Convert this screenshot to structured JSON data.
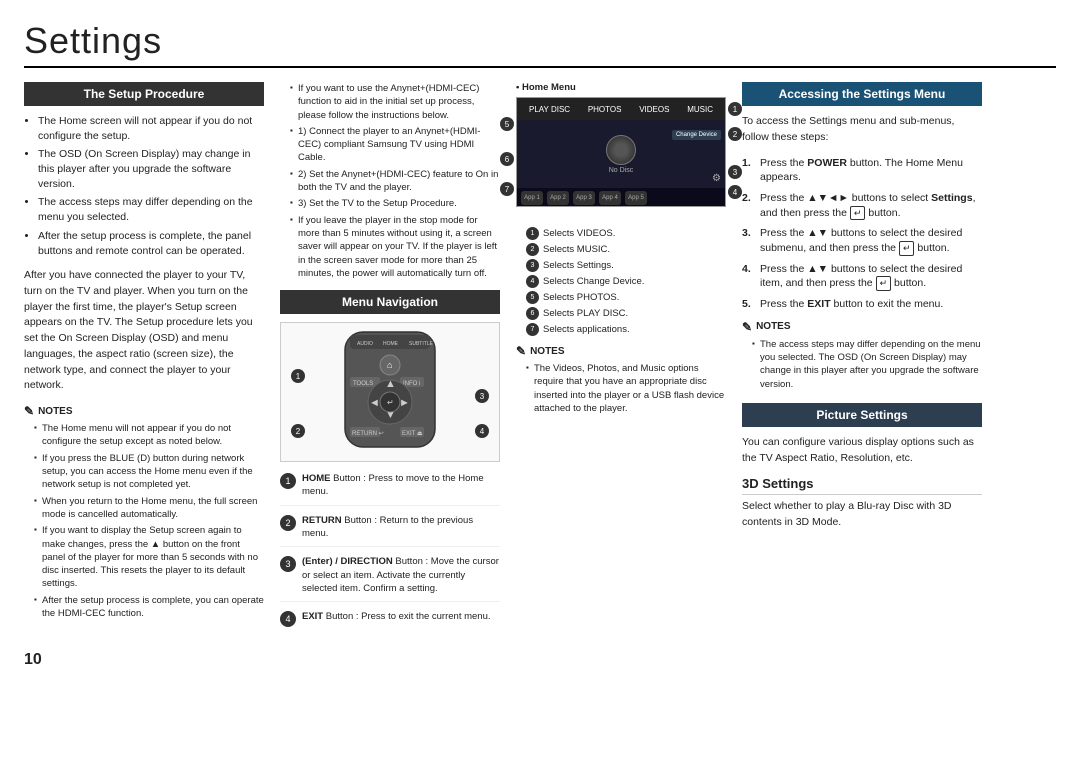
{
  "page": {
    "title": "Settings",
    "page_number": "10"
  },
  "col1": {
    "setup_procedure": {
      "header": "The Setup Procedure",
      "bullets": [
        "The Home screen will not appear if you do not configure the setup.",
        "The OSD (On Screen Display) may change in this player after you upgrade the software version.",
        "The access steps may differ depending on the menu you selected.",
        "After the setup process is complete, the panel buttons and remote control can be operated."
      ],
      "body": "After you have connected the player to your TV, turn on the TV and player. When you turn on the player the first time, the player's Setup screen appears on the TV. The Setup procedure lets you set the On Screen Display (OSD) and menu languages, the aspect ratio (screen size), the network type, and connect the player to your network.",
      "notes_title": "NOTES",
      "notes": [
        "The Home menu will not appear if you do not configure the setup except as noted below.",
        "If you press the BLUE (D) button during network setup, you can access the Home menu even if the network setup is not completed yet.",
        "When you return to the Home menu, the full screen mode is cancelled automatically.",
        "If you want to display the Setup screen again to make changes, press the ▲ button on the front panel of the player for more than 5 seconds with no disc inserted. This resets the player to its default settings.",
        "After the setup process is complete, you can operate the HDMI-CEC function."
      ]
    }
  },
  "col2": {
    "col2_upper_notes": [
      "If you want to use the Anynet+(HDMI-CEC) function to aid in the initial set up process, please follow the instructions below.",
      "1) Connect the player to an Anynet+(HDMI-CEC) compliant Samsung TV using HDMI Cable.",
      "2) Set the Anynet+(HDMI-CEC) feature to On in both the TV and the player.",
      "3) Set the TV to the Setup Procedure.",
      "If you leave the player in the stop mode for more than 5 minutes without using it, a screen saver will appear on your TV. If the player is left in the screen saver mode for more than 25 minutes, the power will automatically turn off."
    ],
    "menu_navigation": {
      "header": "Menu Navigation",
      "callouts": [
        {
          "num": "1",
          "label": ""
        },
        {
          "num": "2",
          "label": ""
        },
        {
          "num": "3",
          "label": ""
        },
        {
          "num": "4",
          "label": ""
        }
      ],
      "button_descs": [
        {
          "num": "1",
          "title": "HOME",
          "text": "Button : Press to move to the Home menu."
        },
        {
          "num": "2",
          "title": "RETURN",
          "text": "Button : Return to the previous menu."
        },
        {
          "num": "3",
          "title": "(Enter) / DIRECTION",
          "text": "Button : Move the cursor or select an item. Activate the currently selected item. Confirm a setting."
        },
        {
          "num": "4",
          "title": "EXIT",
          "text": "Button : Press to exit the current menu."
        }
      ]
    }
  },
  "col3": {
    "home_menu_label": "Home Menu",
    "tv_labels": {
      "top_items": [
        "PLAY DISC",
        "PHOTOS",
        "VIDEOS",
        "MUSIC"
      ],
      "bottom_apps": [
        "App 1",
        "App 2",
        "App 3",
        "App 4",
        "App 5"
      ],
      "right_label": "Change Device",
      "settings_label": "Settings"
    },
    "callout_right": [
      "1",
      "2",
      "3",
      "4"
    ],
    "callout_left": [
      "5",
      "6",
      "7"
    ],
    "menu_items": [
      {
        "num": "1",
        "text": "Selects VIDEOS."
      },
      {
        "num": "2",
        "text": "Selects MUSIC."
      },
      {
        "num": "3",
        "text": "Selects Settings."
      },
      {
        "num": "4",
        "text": "Selects Change Device."
      },
      {
        "num": "5",
        "text": "Selects PHOTOS."
      },
      {
        "num": "6",
        "text": "Selects PLAY DISC."
      },
      {
        "num": "7",
        "text": "Selects applications."
      }
    ],
    "notes_title": "NOTES",
    "notes": [
      "The Videos, Photos, and Music options require that you have an appropriate disc inserted into the player or a USB flash device attached to the player."
    ]
  },
  "col4": {
    "accessing": {
      "header": "Accessing the Settings Menu",
      "body": "To access the Settings menu and sub-menus, follow these steps:",
      "steps": [
        {
          "num": "1.",
          "text": "Press the POWER button. The Home Menu appears."
        },
        {
          "num": "2.",
          "text": "Press the ▲▼◄► buttons to select Settings, and then press the  button."
        },
        {
          "num": "3.",
          "text": "Press the ▲▼ buttons to select the desired submenu, and then press the  button."
        },
        {
          "num": "4.",
          "text": "Press the ▲▼ buttons to select the desired item, and then press the  button."
        },
        {
          "num": "5.",
          "text": "Press the EXIT button to exit the menu."
        }
      ],
      "notes_title": "NOTES",
      "notes": [
        "The access steps may differ depending on the menu you selected. The OSD (On Screen Display) may change in this player after you upgrade the software version."
      ]
    },
    "picture_settings": {
      "header": "Picture Settings",
      "body": "You can configure various display options such as the TV Aspect Ratio, Resolution, etc."
    },
    "settings_3d": {
      "title": "3D Settings",
      "body": "Select whether to play a Blu-ray Disc with 3D contents in 3D Mode."
    }
  }
}
